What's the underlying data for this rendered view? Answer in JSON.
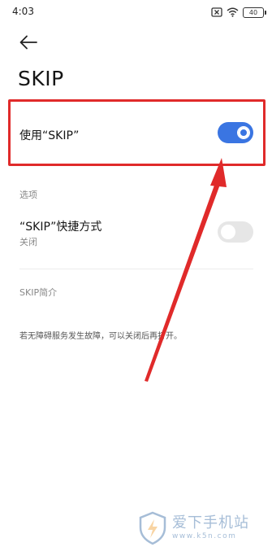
{
  "status_bar": {
    "time": "4:03",
    "battery": "40"
  },
  "header": {
    "title": "SKIP"
  },
  "main_toggle": {
    "label": "使用“SKIP”",
    "state": "on",
    "accent": "#3a75e2"
  },
  "options": {
    "section_label": "选项",
    "shortcut_title": "“SKIP”快捷方式",
    "shortcut_status": "关闭",
    "shortcut_state": "off"
  },
  "intro": {
    "section_label": "SKIP简介",
    "text": "若无障碍服务发生故障，可以关闭后再打开。"
  },
  "annotation": {
    "highlight_color": "#e02a2a"
  },
  "watermark": {
    "title": "爱下手机站",
    "url": "www.k5n.com"
  }
}
